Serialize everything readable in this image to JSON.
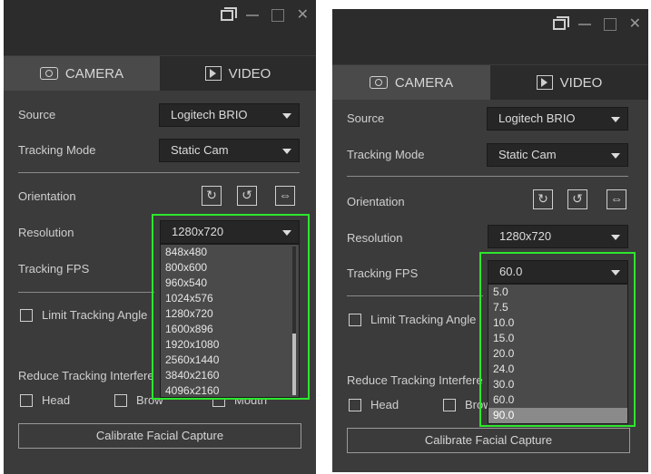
{
  "tabs": {
    "camera": "CAMERA",
    "video": "VIDEO"
  },
  "labels": {
    "source": "Source",
    "tracking_mode": "Tracking Mode",
    "orientation": "Orientation",
    "resolution": "Resolution",
    "tracking_fps": "Tracking FPS",
    "limit_tracking_angle": "Limit Tracking Angle",
    "reduce_tracking": "Reduce Tracking Interfere",
    "head": "Head",
    "brow": "Brow",
    "mouth": "Mouth",
    "calibrate": "Calibrate Facial Capture"
  },
  "left": {
    "source_value": "Logitech BRIO",
    "tracking_mode_value": "Static Cam",
    "resolution_value": "1280x720",
    "resolution_options": [
      "848x480",
      "800x600",
      "960x540",
      "1024x576",
      "1280x720",
      "1600x896",
      "1920x1080",
      "2560x1440",
      "3840x2160",
      "4096x2160"
    ]
  },
  "right": {
    "source_value": "Logitech BRIO",
    "tracking_mode_value": "Static Cam",
    "resolution_value": "1280x720",
    "fps_value": "60.0",
    "fps_options": [
      "5.0",
      "7.5",
      "10.0",
      "15.0",
      "20.0",
      "24.0",
      "30.0",
      "60.0",
      "90.0"
    ],
    "fps_highlighted": "90.0"
  },
  "colors": {
    "highlight": "#2ee62e",
    "panel": "#3b3b3b",
    "titlebar": "#2c2c2c"
  }
}
